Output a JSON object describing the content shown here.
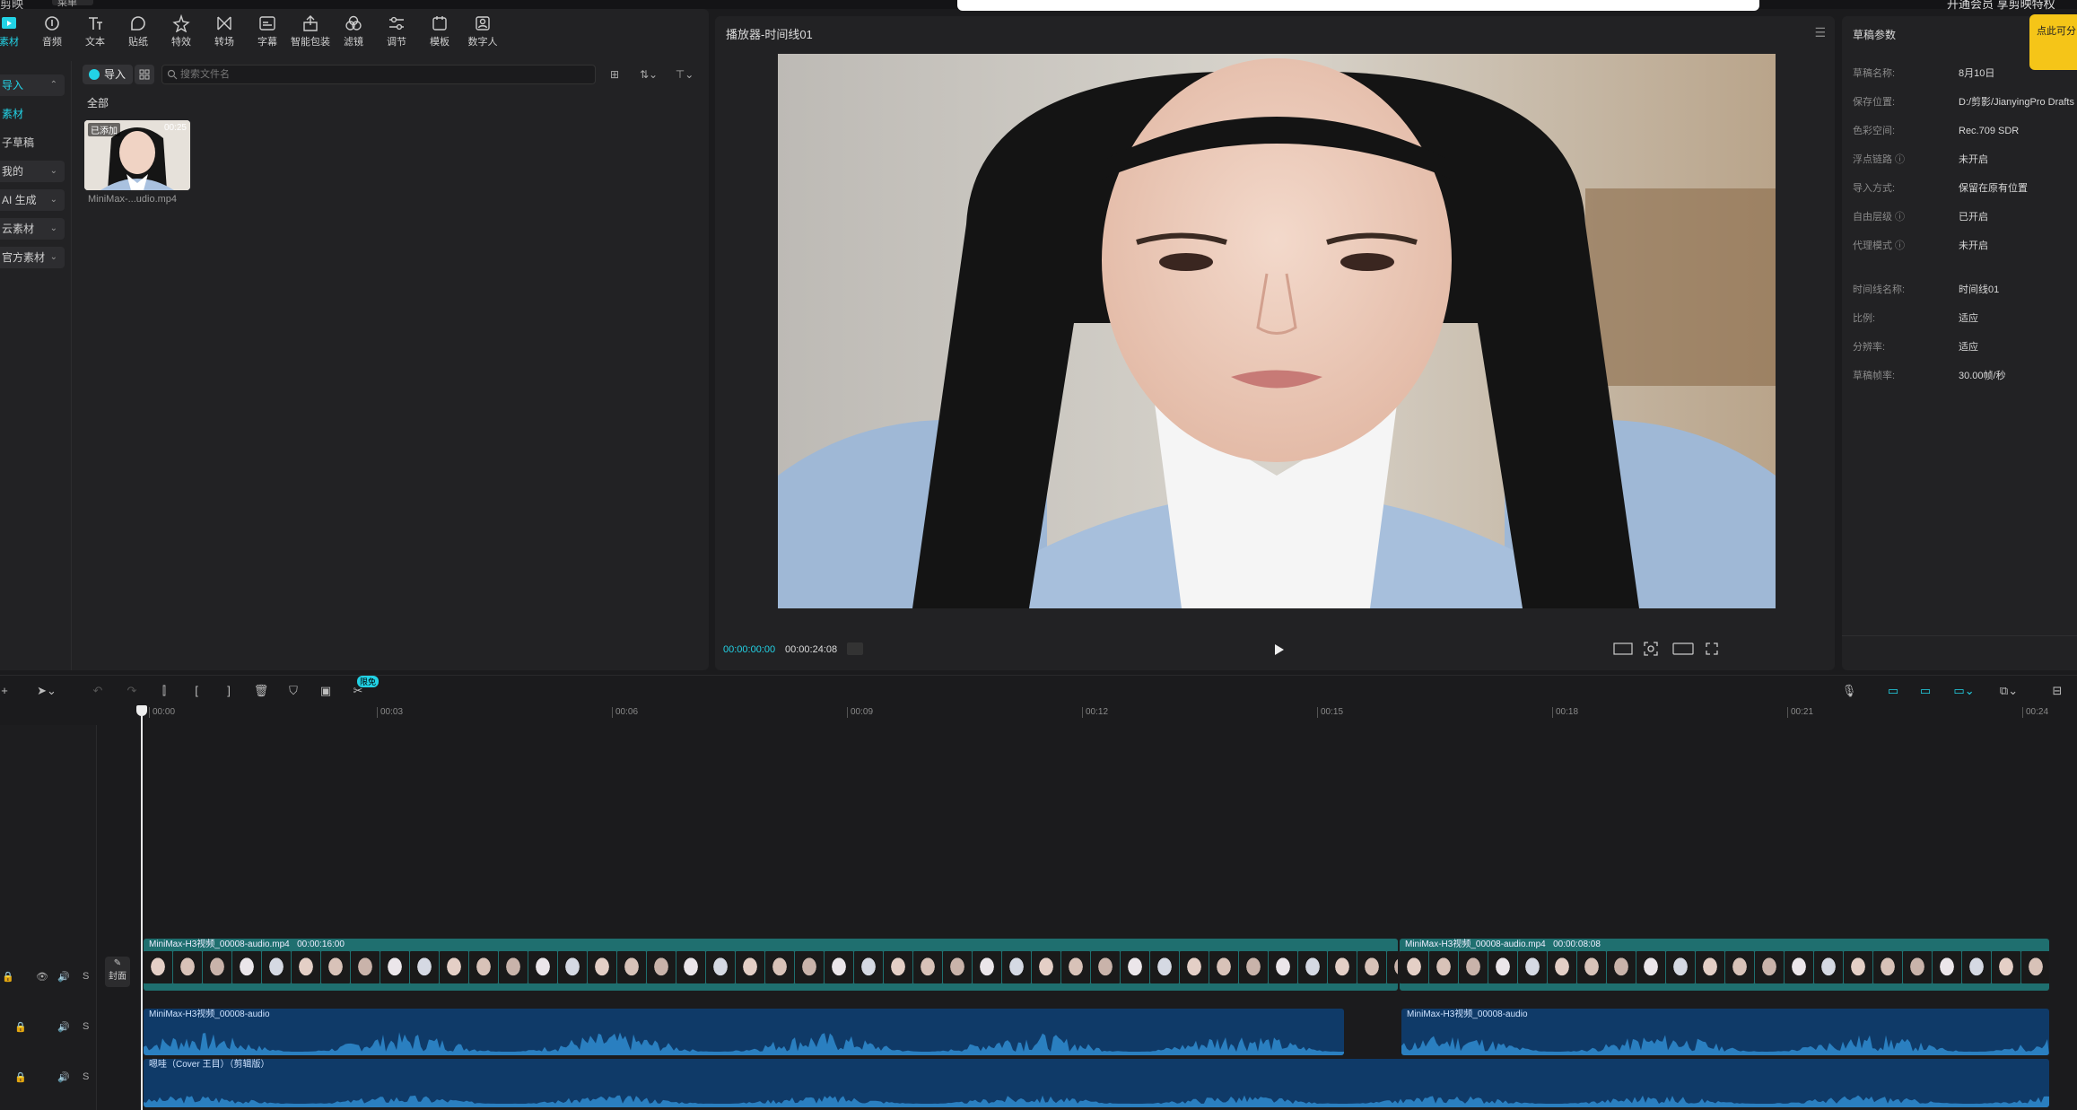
{
  "topbar": {
    "app_title": "剪映",
    "project_label": "菜单",
    "right_text": "开通会员 享剪映特权"
  },
  "toolbar": {
    "items": [
      {
        "label": "素材",
        "icon": "media-icon"
      },
      {
        "label": "音频",
        "icon": "audio-icon"
      },
      {
        "label": "文本",
        "icon": "text-icon"
      },
      {
        "label": "贴纸",
        "icon": "sticker-icon"
      },
      {
        "label": "特效",
        "icon": "effects-icon"
      },
      {
        "label": "转场",
        "icon": "transition-icon"
      },
      {
        "label": "字幕",
        "icon": "subtitle-icon"
      },
      {
        "label": "智能包装",
        "icon": "smart-package-icon"
      },
      {
        "label": "滤镜",
        "icon": "filter-icon"
      },
      {
        "label": "调节",
        "icon": "adjust-icon"
      },
      {
        "label": "模板",
        "icon": "template-icon"
      },
      {
        "label": "数字人",
        "icon": "digital-human-icon"
      }
    ],
    "active_index": 0
  },
  "sidebar": {
    "items": [
      {
        "label": "导入",
        "selected": true,
        "chevron": "⌃"
      },
      {
        "label": "素材",
        "selected": false,
        "chevron": ""
      },
      {
        "label": "子草稿",
        "selected": false,
        "chevron": ""
      },
      {
        "label": "我的",
        "selected": false,
        "chevron": "⌄"
      },
      {
        "label": "AI 生成",
        "selected": false,
        "chevron": "⌄"
      },
      {
        "label": "云素材",
        "selected": false,
        "chevron": "⌄"
      },
      {
        "label": "官方素材",
        "selected": false,
        "chevron": "⌄"
      }
    ]
  },
  "media": {
    "import_label": "导入",
    "search_placeholder": "搜索文件名",
    "filter_all": "全部",
    "file": {
      "tag": "已添加",
      "duration": "00:25",
      "name": "MiniMax-...udio.mp4"
    }
  },
  "player": {
    "title": "播放器-时间线01",
    "current_time": "00:00:00:00",
    "total_time": "00:00:24:08"
  },
  "params": {
    "title": "草稿参数",
    "rows": [
      {
        "key": "草稿名称:",
        "value": "8月10日"
      },
      {
        "key": "保存位置:",
        "value": "D:/剪影/JianyingPro Drafts"
      },
      {
        "key": "色彩空间:",
        "value": "Rec.709 SDR"
      },
      {
        "key": "浮点链路 ⓘ",
        "value": "未开启"
      },
      {
        "key": "导入方式:",
        "value": "保留在原有位置"
      },
      {
        "key": "自由层级 ⓘ",
        "value": "已开启"
      },
      {
        "key": "代理模式 ⓘ",
        "value": "未开启"
      }
    ],
    "rows2": [
      {
        "key": "时间线名称:",
        "value": "时间线01"
      },
      {
        "key": "比例:",
        "value": "适应"
      },
      {
        "key": "分辨率:",
        "value": "适应"
      },
      {
        "key": "草稿帧率:",
        "value": "30.00帧/秒"
      }
    ],
    "sticky_note": "点此可分"
  },
  "timeline": {
    "ruler": [
      "00:00",
      "00:03",
      "00:06",
      "00:09",
      "00:12",
      "00:15",
      "00:18",
      "00:21",
      "00:24"
    ],
    "cover_label": "封面",
    "video_clips": [
      {
        "name": "MiniMax-H3视频_00008-audio.mp4",
        "duration": "00:00:16:00"
      },
      {
        "name": "MiniMax-H3视频_00008-audio.mp4",
        "duration": "00:00:08:08"
      }
    ],
    "audio_clips": [
      {
        "name": "MiniMax-H3视频_00008-audio"
      },
      {
        "name": "MiniMax-H3视频_00008-audio"
      },
      {
        "name": "嗯哇（Cover 王目）（剪辑版）"
      }
    ],
    "badge": "限免"
  },
  "colors": {
    "accent": "#22d3e6",
    "panel": "#222224",
    "video_track": "#1f6f6f",
    "audio_track": "#0f3a68",
    "wave": "#2a7fc0"
  }
}
